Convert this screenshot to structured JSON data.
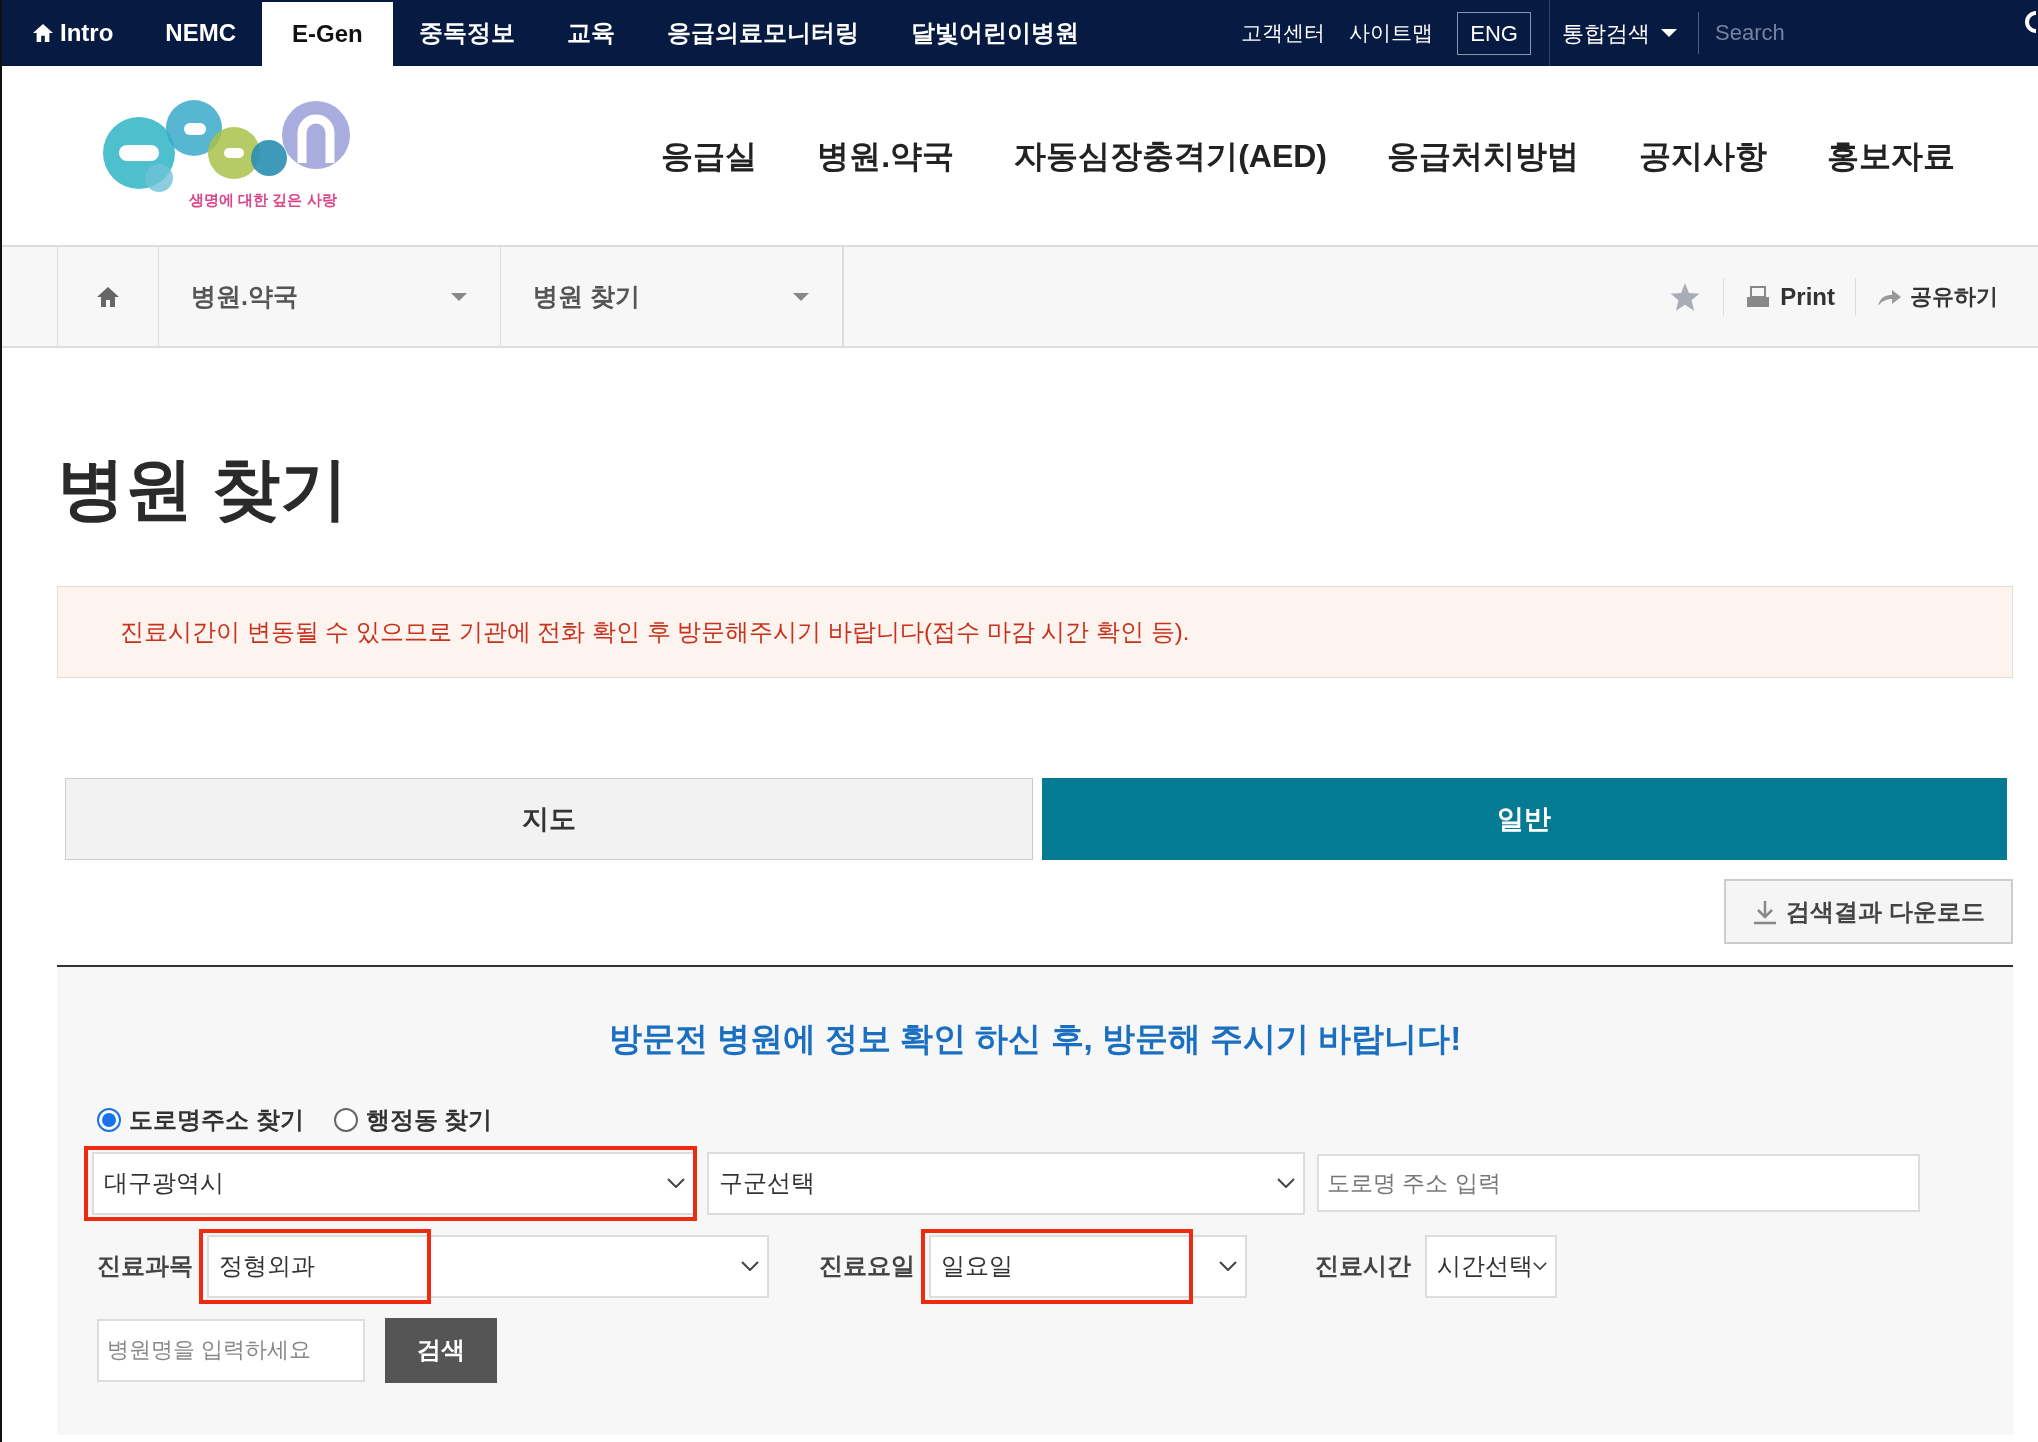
{
  "top_bar": {
    "sites": [
      {
        "label": "Intro",
        "kind": "home",
        "selected": false
      },
      {
        "label": "NEMC",
        "kind": "plain",
        "selected": false
      },
      {
        "label": "E-Gen",
        "kind": "plain",
        "selected": true
      },
      {
        "label": "중독정보",
        "kind": "plain",
        "selected": false
      },
      {
        "label": "교육",
        "kind": "plain",
        "selected": false
      },
      {
        "label": "응급의료모니터링",
        "kind": "plain",
        "selected": false
      },
      {
        "label": "달빛어린이병원",
        "kind": "plain",
        "selected": false
      }
    ],
    "links": [
      "고객센터",
      "사이트맵"
    ],
    "language_button": "ENG",
    "search_scope": "통합검색",
    "search": {
      "placeholder": "Search"
    }
  },
  "header": {
    "logo_tagline": "생명에 대한 깊은 사랑",
    "nav": [
      "응급실",
      "병원.약국",
      "자동심장충격기(AED)",
      "응급처치방법",
      "공지사항",
      "홍보자료"
    ]
  },
  "breadcrumb": {
    "levels": [
      "병원.약국",
      "병원 찾기"
    ],
    "print": "Print",
    "share": "공유하기"
  },
  "page_title": "병원 찾기",
  "notice": "진료시간이 변동될 수 있으므로 기관에 전화 확인 후 방문해주시기 바랍니다(접수 마감 시간 확인 등).",
  "view_tabs": [
    {
      "label": "지도",
      "selected": false
    },
    {
      "label": "일반",
      "selected": true
    }
  ],
  "download_button": "검색결과 다운로드",
  "search_form": {
    "heading": "방문전 병원에 정보 확인 하신 후, 방문해 주시기 바랍니다!",
    "address_modes": [
      {
        "label": "도로명주소 찾기",
        "selected": true
      },
      {
        "label": "행정동 찾기",
        "selected": false
      }
    ],
    "region_select": {
      "value": "대구광역시",
      "highlighted": true
    },
    "district_select": {
      "value": "구군선택",
      "highlighted": false
    },
    "road_address": {
      "placeholder": "도로명 주소 입력"
    },
    "department": {
      "label": "진료과목",
      "value": "정형외과",
      "highlighted": true
    },
    "day": {
      "label": "진료요일",
      "value": "일요일",
      "highlighted": true
    },
    "time": {
      "label": "진료시간",
      "value": "시간선택",
      "highlighted": false
    },
    "hospital_name": {
      "placeholder": "병원명을 입력하세요"
    },
    "search_button": "검색"
  }
}
